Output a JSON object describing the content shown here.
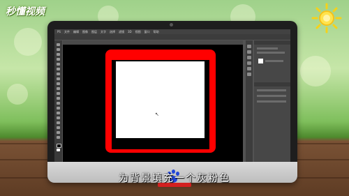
{
  "watermark": {
    "logo_text": "秒懂视频"
  },
  "photoshop": {
    "menu_items": [
      "PS",
      "文件",
      "编辑",
      "图像",
      "图层",
      "文字",
      "选择",
      "滤镜",
      "3D",
      "视图",
      "窗口",
      "帮助"
    ],
    "document_tab": ""
  },
  "subtitle": {
    "text": "为背景填充一个灰粉色"
  },
  "colors": {
    "frame_red": "#ff0000",
    "canvas_white": "#ffffff",
    "workspace_black": "#000000",
    "ps_ui_gray": "#535353"
  }
}
